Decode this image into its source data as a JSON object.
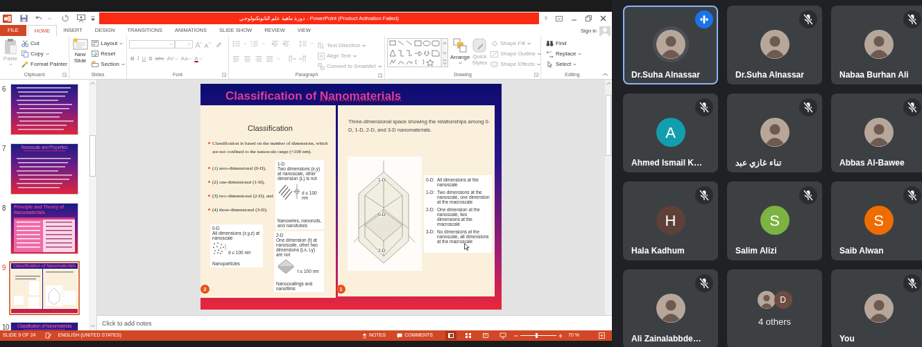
{
  "title_bar": {
    "title": "دورة ماهية علم النانوتكنولوجي - PowerPoint (Product Activation Failed)",
    "help": "?"
  },
  "account": {
    "sign_in": "Sign in"
  },
  "tabs": [
    {
      "label": "FILE",
      "kind": "file",
      "selected": false
    },
    {
      "label": "HOME",
      "kind": "tab",
      "selected": true
    },
    {
      "label": "INSERT",
      "kind": "tab",
      "selected": false
    },
    {
      "label": "DESIGN",
      "kind": "tab",
      "selected": false
    },
    {
      "label": "TRANSITIONS",
      "kind": "tab",
      "selected": false
    },
    {
      "label": "ANIMATIONS",
      "kind": "tab",
      "selected": false
    },
    {
      "label": "SLIDE SHOW",
      "kind": "tab",
      "selected": false
    },
    {
      "label": "REVIEW",
      "kind": "tab",
      "selected": false
    },
    {
      "label": "VIEW",
      "kind": "tab",
      "selected": false
    }
  ],
  "ribbon": {
    "clipboard": {
      "label": "Clipboard",
      "paste": {
        "label": "Paste",
        "disabled": true
      },
      "items": [
        {
          "label": "Cut",
          "dropdown": false
        },
        {
          "label": "Copy",
          "dropdown": true
        },
        {
          "label": "Format Painter",
          "dropdown": false
        }
      ]
    },
    "slides": {
      "label": "Slides",
      "new_slide": "New Slide",
      "items": [
        {
          "label": "Layout",
          "dropdown": true
        },
        {
          "label": "Reset",
          "dropdown": false
        },
        {
          "label": "Section",
          "dropdown": true
        }
      ]
    },
    "font": {
      "label": "Font",
      "disabled": true,
      "buttons": [
        "B",
        "I",
        "U",
        "S",
        "abc",
        "AV",
        "Aa",
        "A"
      ]
    },
    "paragraph": {
      "label": "Paragraph",
      "disabled": true,
      "items": [
        "Text Direction",
        "Align Text",
        "Convert to SmartArt"
      ]
    },
    "drawing": {
      "label": "Drawing",
      "arrange": {
        "label": "Arrange",
        "disabled": false
      },
      "quick_styles": {
        "label": "Quick Styles",
        "disabled": true
      },
      "items_disabled": true,
      "items": [
        "Shape Fill",
        "Shape Outline",
        "Shape Effects"
      ]
    },
    "editing": {
      "label": "Editing",
      "items": [
        {
          "label": "Find",
          "dropdown": false
        },
        {
          "label": "Replace",
          "dropdown": true
        },
        {
          "label": "Select",
          "dropdown": true
        }
      ]
    }
  },
  "thumbnails": [
    {
      "number": "6",
      "kind": "text",
      "selected": false
    },
    {
      "number": "7",
      "kind": "text",
      "title": "Nanoscale and Properties",
      "selected": false
    },
    {
      "number": "8",
      "kind": "table",
      "title": "Principle and Theory of Nanomaterials",
      "selected": false
    },
    {
      "number": "9",
      "kind": "split",
      "title": "Classification of Nanomaterials",
      "selected": true
    },
    {
      "number": "10",
      "kind": "text",
      "title": "Classification of Nanomaterials",
      "selected": false
    }
  ],
  "slide": {
    "title_words": [
      {
        "text": "Classification of",
        "misspelled": false
      },
      {
        "text": "Nanomaterials",
        "misspelled": true
      }
    ],
    "left": {
      "heading": "Classification",
      "bullets": [
        "Classification is based on the number of dimensions, which are not confined to the nanoscale range (<100 nm).",
        "(1) zero-dimensional (0-D),",
        "(2) one-dimensional (1-D),",
        "(3) two-dimensional (2-D), and",
        "(4) three-dimensional (3-D)."
      ],
      "figures": [
        {
          "kind": "wire",
          "label": "1-D",
          "caption": "Two dimensions (x,y) at nanoscale, other dimension (L) is not",
          "measure": "d ≤ 100 nm",
          "footer": "Nanowires, nanorods, and nanotubes"
        },
        {
          "kind": "particle",
          "label": "0-D",
          "caption": "All dimensions (x,y,z) at nanoscale",
          "measure": "d ≤ 100 nm",
          "footer": "Nanoparticles"
        },
        {
          "kind": "film",
          "label": "2-D",
          "caption": "One dimension (t) at nanoscale, other two dimensions (Lx, Ly) are not",
          "measure": "t ≤ 100 nm",
          "footer": "Nanocoatings and nanofilms"
        }
      ],
      "page": "2"
    },
    "right": {
      "text": "Three-dimensional space showing the relationships among 0-D, 1-D, 2-D, and 3-D nanomaterials.",
      "diagram_labels": [
        "1-D",
        "0-D",
        "2-D"
      ],
      "legend": [
        {
          "code": "0-D:",
          "text": "All dimensions at the nanoscale"
        },
        {
          "code": "1-D:",
          "text": "Two dimensions at the nanoscale, one dimension at the macroscale"
        },
        {
          "code": "2-D:",
          "text": "One dimension at the nanoscale, two dimensions at the macroscale"
        },
        {
          "code": "3-D:",
          "text": "No dimensions at the nanoscale, all dimensions at the macroscale"
        }
      ],
      "page": "1"
    }
  },
  "notes": {
    "placeholder": "Click to add notes"
  },
  "status_bar": {
    "slide_info": "SLIDE 9 OF 24",
    "language": "ENGLISH (UNITED STATES)",
    "notes": "NOTES",
    "comments": "COMMENTS",
    "views": [
      {
        "selected": true
      },
      {
        "selected": false
      },
      {
        "selected": false
      },
      {
        "selected": false
      }
    ],
    "zoom": {
      "level": 0.45,
      "reading": "70 %"
    }
  },
  "participants": [
    {
      "name": "Dr.Suha Alnassar",
      "kind": "photo",
      "speaking": true,
      "muted": false,
      "active": true
    },
    {
      "name": "Dr.Suha Alnassar",
      "kind": "photo",
      "speaking": false,
      "muted": true,
      "active": false
    },
    {
      "name": "Nabaa Burhan Ali",
      "kind": "photo",
      "speaking": false,
      "muted": true,
      "active": false
    },
    {
      "name": "Ahmed Ismail K…",
      "kind": "letter",
      "letter": "A",
      "color": "#129eaf",
      "speaking": false,
      "muted": true,
      "active": false
    },
    {
      "name": "تناء غازي عبد",
      "kind": "photo",
      "speaking": false,
      "muted": true,
      "active": false
    },
    {
      "name": "Abbas Al-Bawee",
      "kind": "photo",
      "speaking": false,
      "muted": true,
      "active": false
    },
    {
      "name": "Hala Kadhum",
      "kind": "letter",
      "letter": "H",
      "color": "#5d4037",
      "speaking": false,
      "muted": true,
      "active": false
    },
    {
      "name": "Salim Alizi",
      "kind": "letter",
      "letter": "S",
      "color": "#7cb342",
      "speaking": false,
      "muted": true,
      "active": false
    },
    {
      "name": "Saib Alwan",
      "kind": "letter",
      "letter": "S",
      "color": "#ef6c00",
      "speaking": false,
      "muted": true,
      "active": false
    },
    {
      "name": "Ali Zainalabbde…",
      "kind": "photo",
      "speaking": false,
      "muted": true,
      "active": false
    },
    {
      "name": "4 others",
      "kind": "group",
      "members": [
        {
          "kind": "photo"
        },
        {
          "kind": "letter",
          "letter": "D",
          "color": "#6d4c41"
        }
      ],
      "speaking": false,
      "muted": false,
      "active": false
    },
    {
      "name": "You",
      "kind": "photo",
      "speaking": false,
      "muted": true,
      "active": false
    }
  ]
}
